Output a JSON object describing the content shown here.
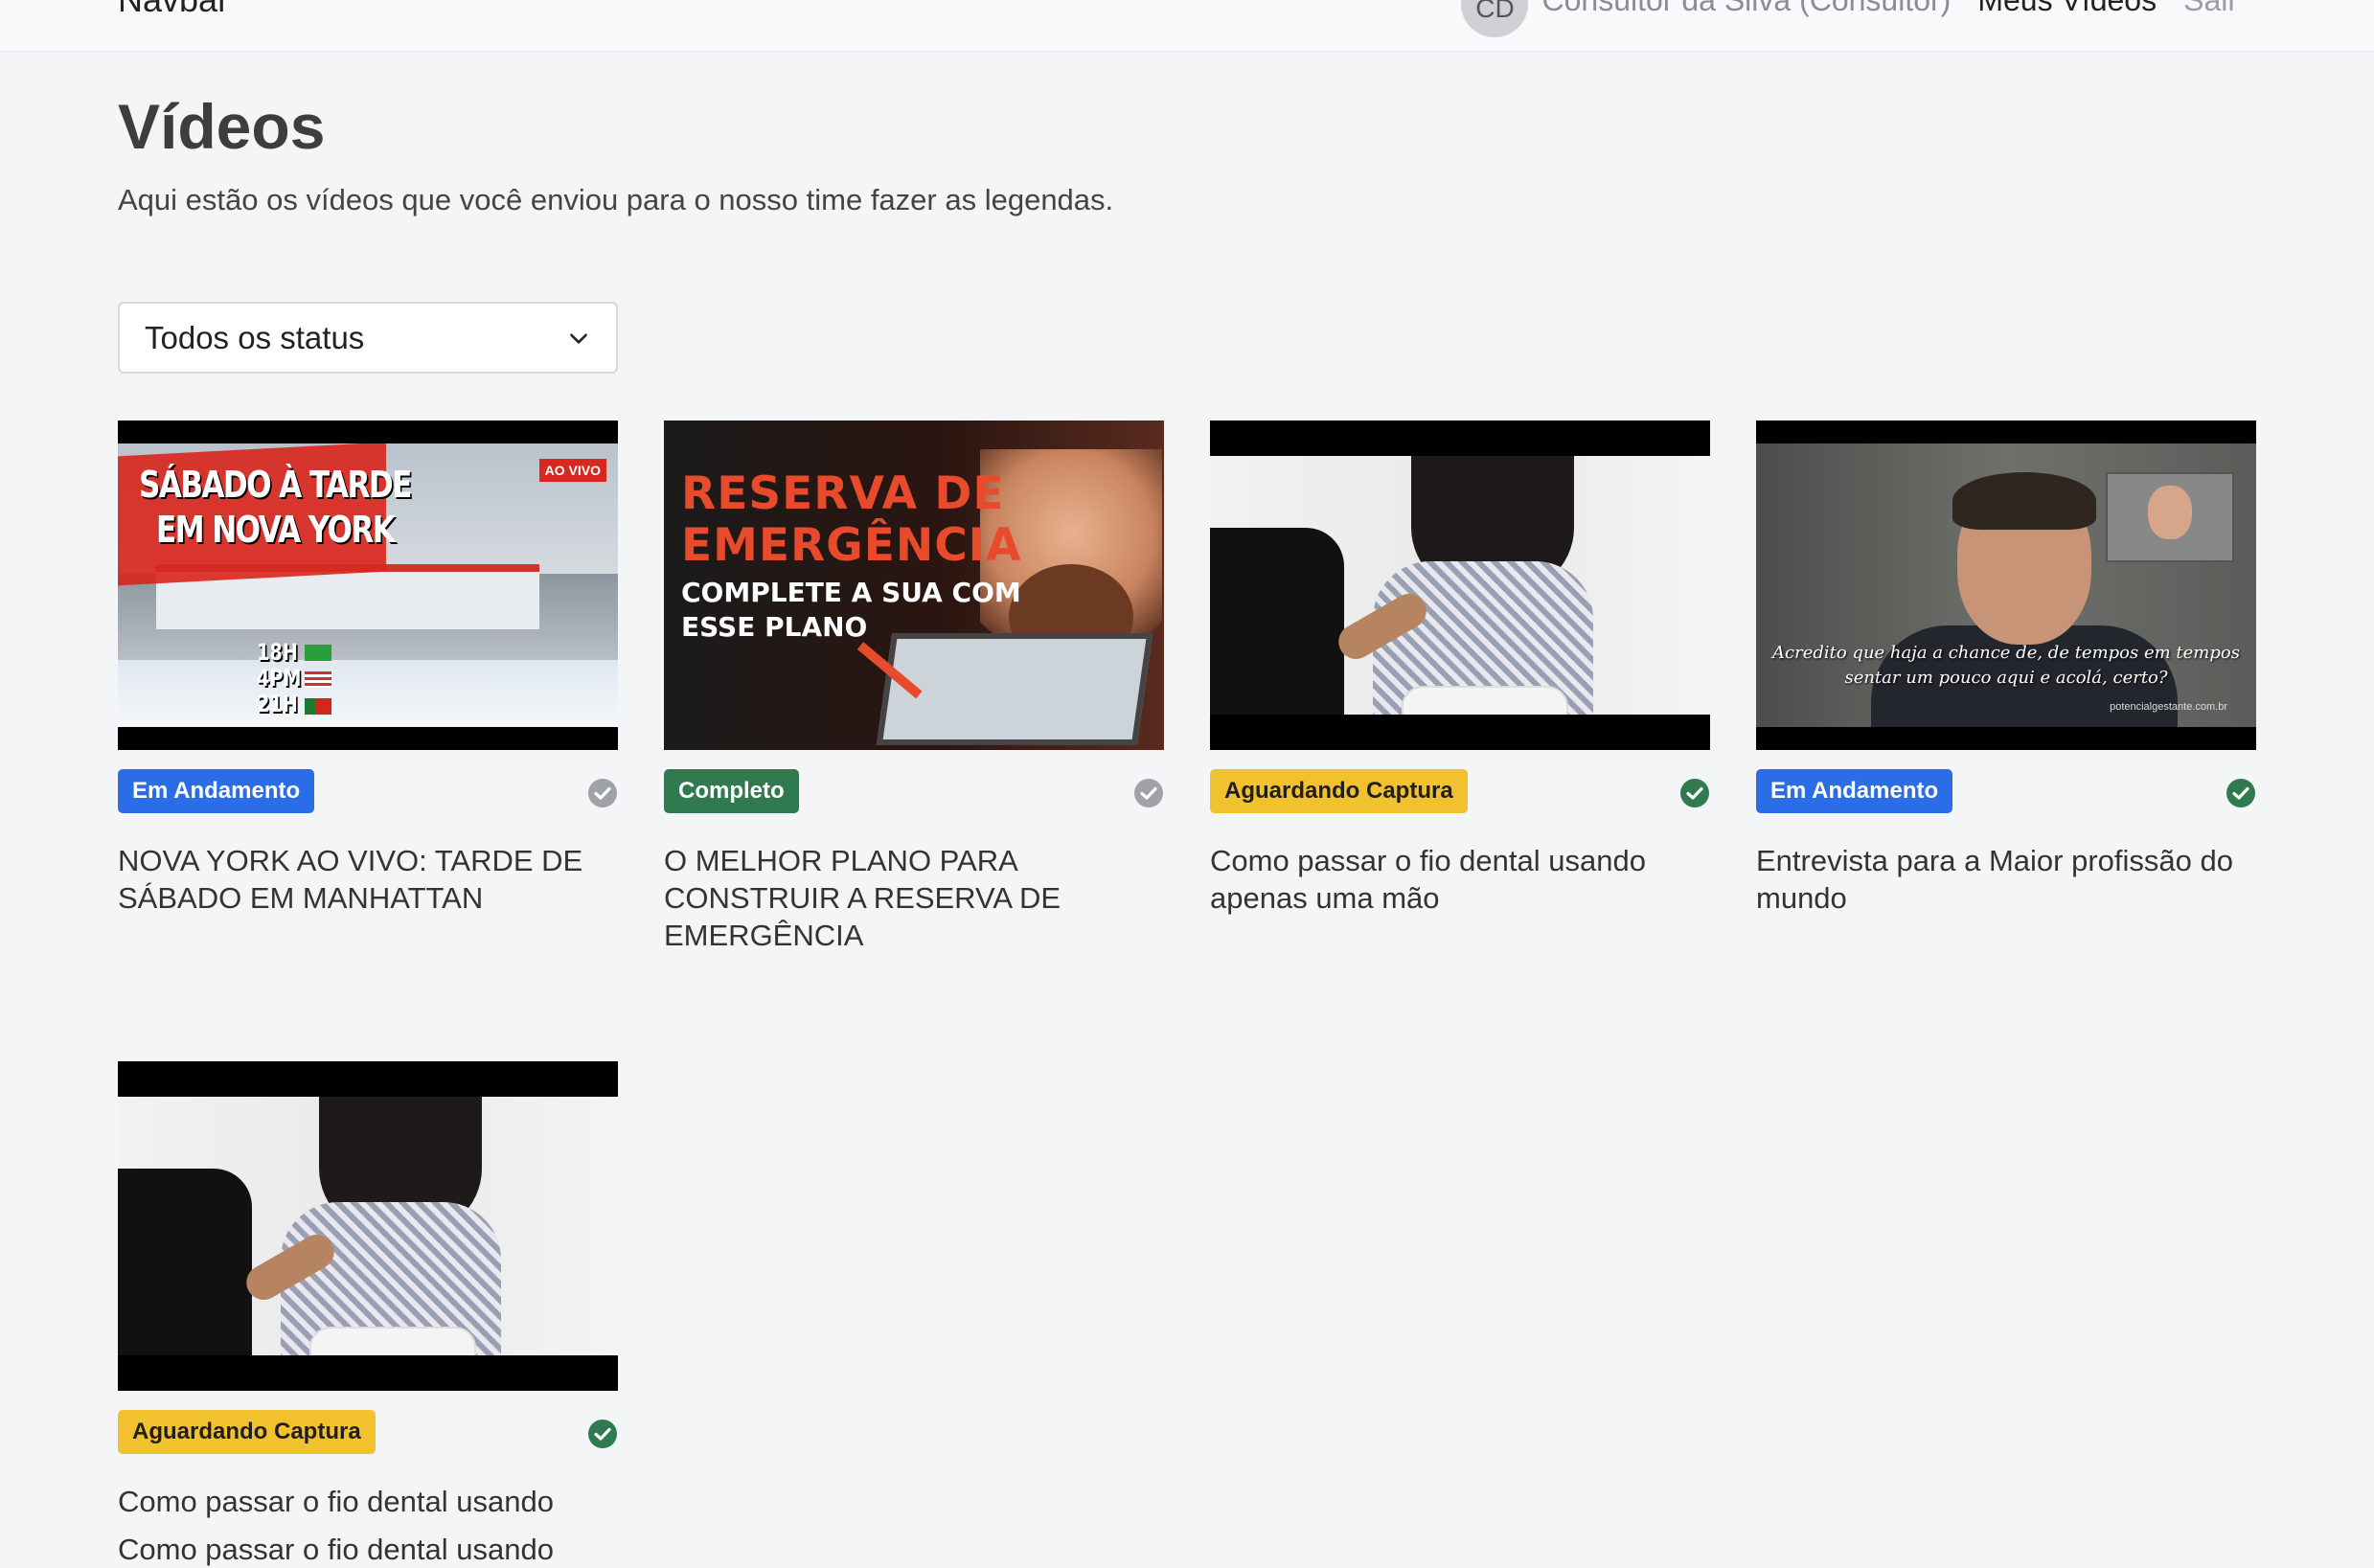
{
  "navbar": {
    "brand": "Navbar",
    "avatar_initials": "CD",
    "user_name": "Consultor da Silva (Consultor)",
    "links": [
      "Meus Vídeos",
      "Sair"
    ]
  },
  "page": {
    "title": "Vídeos",
    "subtitle": "Aqui estão os vídeos que você enviou para o nosso time fazer as legendas."
  },
  "filter": {
    "selected": "Todos os status"
  },
  "videos": [
    {
      "status": "Em Andamento",
      "status_color": "#2b6de6",
      "check_color": "#a0a3a6",
      "title": "NOVA YORK AO VIVO: TARDE DE SÁBADO EM MANHATTAN",
      "thumb_text": {
        "line1": "SÁBADO À TARDE",
        "line2": "EM NOVA YORK",
        "live": "AO VIVO",
        "times": [
          "18H",
          "4PM",
          "21H"
        ]
      }
    },
    {
      "status": "Completo",
      "status_color": "#2f7a4e",
      "check_color": "#a0a3a6",
      "title": "O MELHOR PLANO PARA CONSTRUIR A RESERVA DE EMERGÊNCIA",
      "thumb_text": {
        "line1": "RESERVA DE",
        "line2": "EMERGÊNCIA",
        "line3": "COMPLETE A SUA COM",
        "line4": "ESSE PLANO"
      }
    },
    {
      "status": "Aguardando Captura",
      "status_color": "#f2c12e",
      "check_color": "#2f7a4e",
      "title": "Como passar o fio dental usando apenas uma mão"
    },
    {
      "status": "Em Andamento",
      "status_color": "#2b6de6",
      "check_color": "#2f7a4e",
      "title": "Entrevista para a Maior profissão do mundo",
      "thumb_text": {
        "caption1": "Acredito que haja a chance de, de tempos em tempos",
        "caption2": "sentar um pouco aqui e acolá, certo?",
        "watermark": "potencialgestante.com.br"
      }
    },
    {
      "status": "Aguardando Captura",
      "status_color": "#f2c12e",
      "check_color": "#2f7a4e",
      "title": "Como passar o fio dental usando",
      "title_extra": "Como passar o fio dental usando"
    }
  ]
}
